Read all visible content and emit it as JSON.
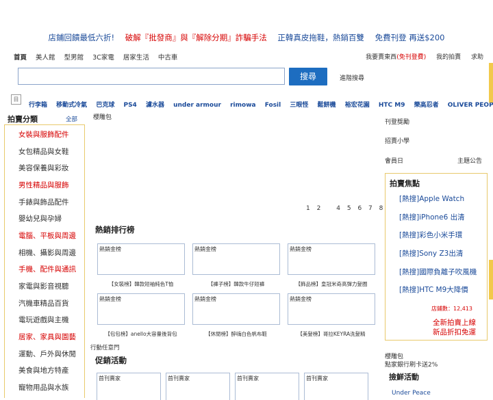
{
  "promo_bar": [
    {
      "text": "店鋪回饋最低六折!",
      "color": "#1a4a99"
    },
    {
      "text": "破解『批發商』與『解除分期』詐騙手法",
      "color": "#d60000"
    },
    {
      "text": "正韓真皮拖鞋，熱銷百雙",
      "color": "#1a4a99"
    },
    {
      "text": "免費刊登 再送$200",
      "color": "#1a4a99"
    }
  ],
  "nav": {
    "items": [
      "首頁",
      "美人館",
      "型男館",
      "3C家電",
      "居家生活",
      "中古車"
    ],
    "right": [
      "我要賣東西",
      "(免刊登費)",
      "我的拍賣",
      "求助"
    ]
  },
  "search": {
    "value": "",
    "button_label": "搜尋",
    "advanced_label": "進階搜尋"
  },
  "hot_keywords": {
    "icon_text": "目",
    "items": [
      "行李箱",
      "移動式冷氣",
      "巴克球",
      "PS4",
      "濾水器",
      "under armour",
      "rimowa",
      "Fosil",
      "三眼怪",
      "鬆餅機",
      "裕宏花園",
      "HTC M9",
      "樂高忍者",
      "OLIVER PEOPLES"
    ],
    "sub_item": "櫻雕包"
  },
  "categories": {
    "title": "拍賣分類",
    "all_label": "全部",
    "items": [
      {
        "label": "女裝與服飾配件",
        "highlight": true
      },
      {
        "label": "女包精品與女鞋",
        "highlight": false
      },
      {
        "label": "美容保養與彩妝",
        "highlight": false
      },
      {
        "label": "男性精品與服飾",
        "highlight": true
      },
      {
        "label": "手錶與飾品配件",
        "highlight": false
      },
      {
        "label": "嬰幼兒與孕婦",
        "highlight": false
      },
      {
        "label": "電腦、平板與周邊",
        "highlight": true
      },
      {
        "label": "相機、攝影與周邊",
        "highlight": false
      },
      {
        "label": "手機、配件與通訊",
        "highlight": true
      },
      {
        "label": "家電與影音視聽",
        "highlight": false
      },
      {
        "label": "汽機車精品百貨",
        "highlight": false
      },
      {
        "label": "電玩遊戲與主機",
        "highlight": false
      },
      {
        "label": "居家、家具與園藝",
        "highlight": true
      },
      {
        "label": "運動、戶外與休閒",
        "highlight": false
      },
      {
        "label": "美食與地方特產",
        "highlight": false
      },
      {
        "label": "寵物用品與水族",
        "highlight": false
      }
    ]
  },
  "pager": [
    "1",
    "2",
    "4",
    "5",
    "6",
    "7",
    "8"
  ],
  "hot_ranking": {
    "title": "熱銷排行榜",
    "items": [
      {
        "label": "熱銷金榜",
        "caption": "【女裝榜】韓款短袖純色T恤"
      },
      {
        "label": "熱銷金榜",
        "caption": "【褲子榜】韓款牛仔短褲"
      },
      {
        "label": "熱銷金榜",
        "caption": "【飾品榜】皇冠米奇高彈力髮圈"
      },
      {
        "label": "熱銷金榜",
        "caption": "【包包榜】anello大容量後背包"
      },
      {
        "label": "熱銷金榜",
        "caption": "【休閒榜】醉嗨白色帆布鞋"
      },
      {
        "label": "熱銷金榜",
        "caption": "【美髮榜】哥拉KEYRA洗髮精"
      }
    ]
  },
  "action_label": "行動任意門",
  "promotions": {
    "title": "促銷活動",
    "items": [
      "首刊賣家",
      "首刊賣家",
      "首刊賣家",
      "首刊賣家"
    ]
  },
  "right_sidebar": {
    "top_links": [
      "刊登獎勵",
      "招賣小學",
      "會員日",
      "主題公告"
    ],
    "focus_title": "拍賣焦點",
    "focus_items": [
      "[熱搜]Apple Watch",
      "[熱搜]iPhone6 出清",
      "[熱搜]彩色小米手環",
      "[熱搜]Sony Z3出清",
      "[熱搜]國際負離子吹風機",
      "[熱搜]HTC M9大降價"
    ],
    "count_label": "店鋪數：12,413",
    "new_lines": [
      "全新拍賣上線",
      "新品折扣免運"
    ],
    "bottom_links": [
      "櫻雕包",
      "點家銀行刷卡送2%"
    ],
    "bargain_title": "撿鮮活動",
    "bargain_item": "Under Peace"
  },
  "colors": {
    "accent": "#1d6dc0",
    "red": "#d60000",
    "gold_border": "#e8c96a",
    "link": "#1a4a99"
  }
}
